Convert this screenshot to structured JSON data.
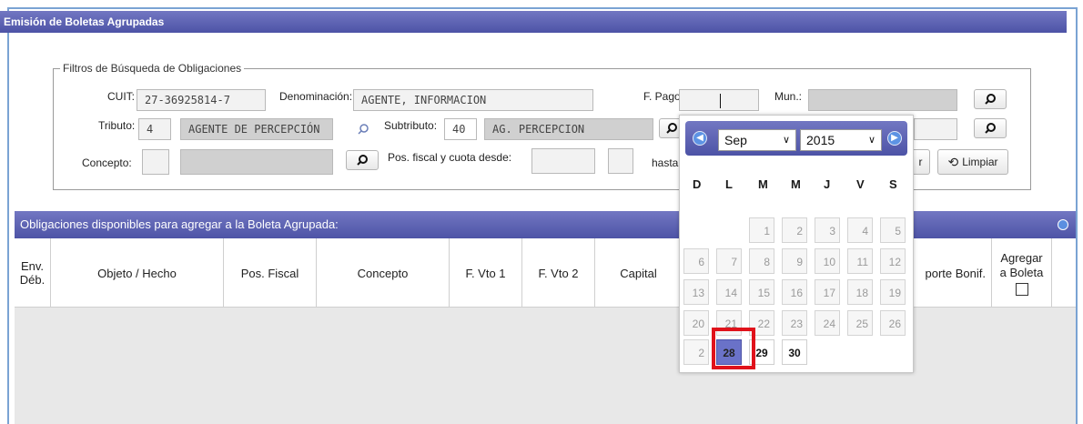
{
  "window": {
    "title": "Emisión de Boletas Agrupadas"
  },
  "filters": {
    "legend": "Filtros de Búsqueda de Obligaciones",
    "cuit_label": "CUIT:",
    "cuit_value": "27-36925814-7",
    "denominacion_label": "Denominación:",
    "denominacion_value": "AGENTE, INFORMACION",
    "fpago_label": "F. Pago:",
    "fpago_value": "",
    "mun_label": "Mun.:",
    "mun_value": "",
    "tributo_label": "Tributo:",
    "tributo_code": "4",
    "tributo_desc": "AGENTE DE PERCEPCIÓN",
    "subtributo_label": "Subtributo:",
    "subtributo_code": "40",
    "subtributo_desc": "AG. PERCEPCION",
    "concepto_label": "Concepto:",
    "concepto_code": "",
    "concepto_desc": "",
    "posfiscal_label": "Pos. fiscal y cuota desde:",
    "hasta_label": "hasta",
    "buscar_label": "r",
    "limpiar_label": "Limpiar"
  },
  "grid": {
    "title": "Obligaciones disponibles para agregar a la Boleta Agrupada:",
    "columns": [
      "Env. Déb.",
      "Objeto / Hecho",
      "Pos. Fiscal",
      "Concepto",
      "F. Vto 1",
      "F. Vto 2",
      "Capital",
      "porte Bonif.",
      "Agregar a Boleta"
    ]
  },
  "calendar": {
    "month": "Sep",
    "year": "2015",
    "weekdays": [
      "D",
      "L",
      "M",
      "M",
      "J",
      "V",
      "S"
    ],
    "weeks": [
      [
        "",
        "",
        "",
        "1",
        "2",
        "3",
        "4",
        "5"
      ],
      [
        "6",
        "7",
        "8",
        "9",
        "10",
        "11",
        "12"
      ],
      [
        "13",
        "14",
        "15",
        "16",
        "17",
        "18",
        "19"
      ],
      [
        "20",
        "21",
        "22",
        "23",
        "24",
        "25",
        "26"
      ],
      [
        "2",
        "28",
        "29",
        "30"
      ]
    ],
    "selected_day": "28"
  },
  "colors": {
    "header": "#5a5fb0",
    "highlight": "#e0121b",
    "selected_day": "#6a72c8"
  }
}
